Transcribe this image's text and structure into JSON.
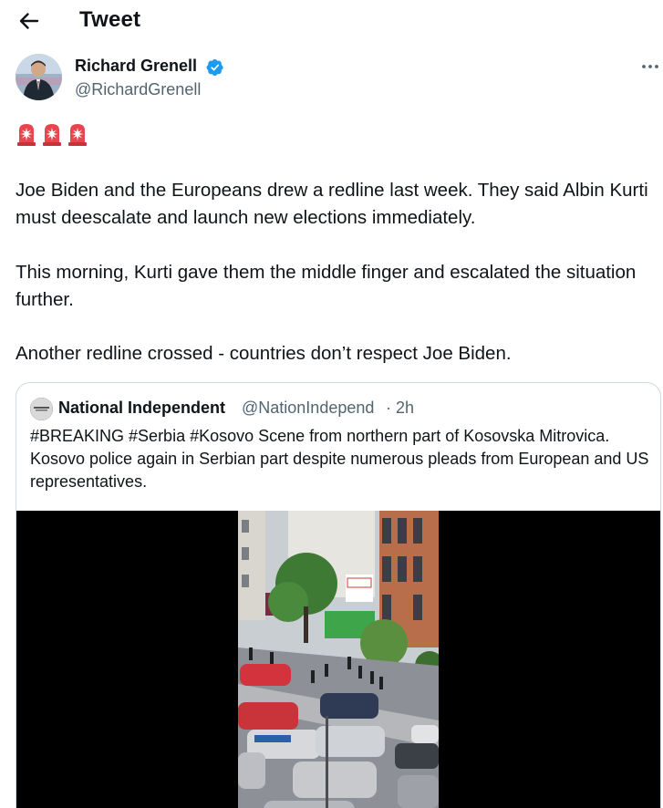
{
  "header": {
    "title": "Tweet",
    "back_icon": "arrow-left-icon"
  },
  "author": {
    "name": "Richard Grenell",
    "handle": "@RichardGrenell",
    "verified_icon": "verified-badge-icon",
    "more_icon": "more-horizontal-icon"
  },
  "tweet": {
    "emoji": [
      "siren-emoji",
      "siren-emoji",
      "siren-emoji"
    ],
    "paragraphs": [
      "Joe Biden and the Europeans drew a redline last week. They said Albin Kurti must deescalate and launch new elections immediately.",
      "This morning, Kurti gave them the middle finger and escalated the situation further.",
      "Another redline crossed - countries don’t respect Joe Biden."
    ]
  },
  "quote": {
    "name": "National Independent",
    "handle": "@NationIndepend",
    "time": "· 2h",
    "text": "#BREAKING #Serbia #Kosovo Scene from northern part of Kosovska Mitrovica. Kosovo police again in Serbian part despite numerous pleads from European and US representatives.",
    "media_type": "video"
  },
  "colors": {
    "text": "#0f1419",
    "secondary": "#536471",
    "verified": "#1d9bf0",
    "border": "#cfd9de"
  }
}
